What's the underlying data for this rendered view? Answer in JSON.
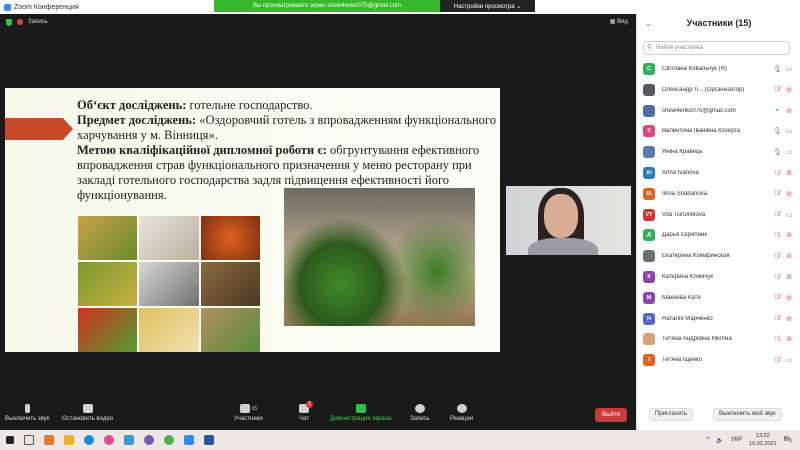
{
  "window": {
    "title": "Zoom Конференция"
  },
  "banner": {
    "text": "Вы просматриваете экран shew4enko075@gmail.com",
    "view_settings": "Настройки просмотра ⌄"
  },
  "topbar": {
    "recording": "Запись",
    "view": "▦ Вид"
  },
  "slide": {
    "line1_bold": "Об‘єкт досліджень:",
    "line1": " готельне господарство.",
    "line2_bold": "Предмет досліджень:",
    "line2": " «Оздоровчий готель з впровадженням функціонального харчування у м. Вінниця».",
    "line3_bold": "Метою кваліфікаційної дипломної роботи є:",
    "line3": " обгрунтування ефективного впровадження страв функціонального призначення у меню ресторану при закладі готельного господарства задля підвищення ефективності його функціонування."
  },
  "toolbar": {
    "mute": "Выключить звук",
    "video": "Остановить видео",
    "participants": "Участники",
    "participants_count": "15",
    "chat": "Чат",
    "chat_badge": "1",
    "share": "Демонстрация экрана",
    "record": "Запись",
    "reactions": "Реакции",
    "leave": "Выйти"
  },
  "panel": {
    "title": "Участники (15)",
    "search_placeholder": "Найти участника",
    "participants": [
      {
        "initials": "С",
        "name": "Світлана Ковальчук (Я)",
        "color": "#2fb25a",
        "mic": "on",
        "cam": "off"
      },
      {
        "initials": "",
        "name": "Олександр Л...  (Организатор)",
        "color": "#555b63",
        "mic": "muted",
        "cam": "muted"
      },
      {
        "initials": "",
        "name": "shew4enko075@gmail.com",
        "color": "#4a6fa5",
        "mic": "share",
        "cam": "muted"
      },
      {
        "initials": "Х",
        "name": "Валентина Іванівна Кохерга",
        "color": "#e0457b",
        "mic": "on",
        "cam": "off"
      },
      {
        "initials": "",
        "name": "Яніна Кравець",
        "color": "#5a7bb0",
        "mic": "on",
        "cam": "off"
      },
      {
        "initials": "AI",
        "name": "Anna Ivanova",
        "color": "#2a7bbd",
        "mic": "muted",
        "cam": "muted"
      },
      {
        "initials": "IS",
        "name": "Ilona Shabanova",
        "color": "#e0641e",
        "mic": "muted",
        "cam": "muted"
      },
      {
        "initials": "VT",
        "name": "Vita Tsirulnikova",
        "color": "#d8322c",
        "mic": "muted",
        "cam": "off"
      },
      {
        "initials": "Д",
        "name": "Дарья Скрипник",
        "color": "#2fb25a",
        "mic": "muted",
        "cam": "muted"
      },
      {
        "initials": "",
        "name": "Екатерина Комаринская",
        "color": "#6b6f73",
        "mic": "muted",
        "cam": "muted"
      },
      {
        "initials": "К",
        "name": "Катерина Климчук",
        "color": "#8e44ad",
        "mic": "muted",
        "cam": "muted"
      },
      {
        "initials": "М",
        "name": "Макеева Катя",
        "color": "#8e44ad",
        "mic": "muted",
        "cam": "muted"
      },
      {
        "initials": "Н",
        "name": "Наталія Марченко",
        "color": "#5468c4",
        "mic": "muted",
        "cam": "muted"
      },
      {
        "initials": "",
        "name": "Тетяна Андріївна Нікітіна",
        "color": "#d9a07a",
        "mic": "muted",
        "cam": "muted"
      },
      {
        "initials": "Т",
        "name": "Тетяна Іщенко",
        "color": "#e0641e",
        "mic": "muted",
        "cam": "off"
      }
    ],
    "invite": "Пригласить",
    "mute_me": "Выключить мой звук"
  },
  "taskbar": {
    "lang": "УКР",
    "time": "13:22",
    "date": "16.02.2021",
    "notif": "5"
  }
}
